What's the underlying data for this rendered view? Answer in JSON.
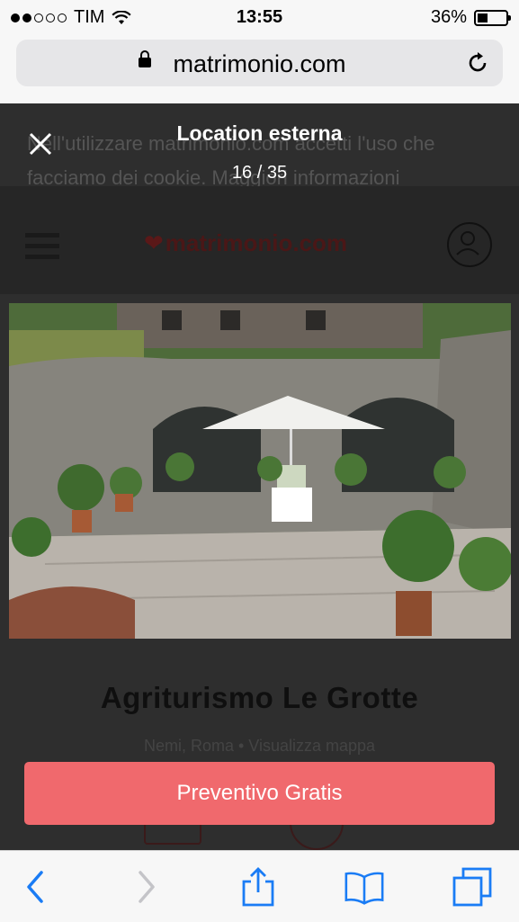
{
  "status_bar": {
    "carrier": "TIM",
    "time": "13:55",
    "battery_percent": "36%",
    "signal_bars_filled": 2,
    "signal_bars_total": 5,
    "battery_level": 0.36
  },
  "browser": {
    "url": "matrimonio.com"
  },
  "background_page": {
    "cookie_text": "Nell'utilizzare matrimonio.com accetti l'uso che facciamo dei cookie. Maggiori informazioni",
    "logo_text": "matrimonio.com",
    "venue_name": "Agriturismo Le Grotte",
    "venue_location": "Nemi, Roma • Visualizza mappa"
  },
  "gallery": {
    "title": "Location esterna",
    "counter": "16 / 35"
  },
  "cta": {
    "label": "Preventivo Gratis"
  },
  "colors": {
    "accent": "#f0696d",
    "overlay": "#2e2e2e",
    "ios_blue": "#1a7cf5"
  },
  "icons": [
    "lock-icon",
    "reload-icon",
    "close-icon",
    "menu-icon",
    "user-icon",
    "back-icon",
    "forward-icon",
    "share-icon",
    "bookmarks-icon",
    "tabs-icon"
  ]
}
